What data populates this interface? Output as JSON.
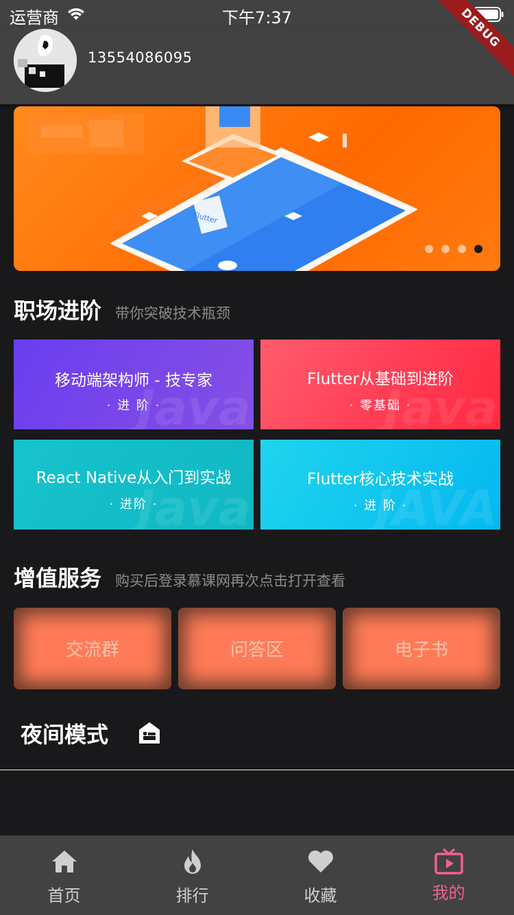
{
  "status_bar": {
    "carrier": "运营商",
    "time": "下午7:37"
  },
  "debug_banner": "DEBUG",
  "header": {
    "username": "13554086095"
  },
  "banner": {
    "page_count": 4,
    "active_page": 4,
    "accent_color": "#ff6a00",
    "illustration_label": "Flutter"
  },
  "career_section": {
    "title": "职场进阶",
    "subtitle": "带你突破技术瓶颈",
    "courses": [
      {
        "title": "移动端架构师 - 技专家",
        "level": "· 进 阶 ·",
        "watermark": "Java"
      },
      {
        "title": "Flutter从基础到进阶",
        "level": "· 零基础 ·",
        "watermark": "Java"
      },
      {
        "title": "React Native从入门到实战",
        "level": "·   进阶   ·",
        "watermark": "Java"
      },
      {
        "title": "Flutter核心技术实战",
        "level": "· 进 阶 ·",
        "watermark": "JAVA"
      }
    ]
  },
  "value_section": {
    "title": "增值服务",
    "subtitle": "购买后登录慕课网再次点击打开查看",
    "buttons": [
      {
        "label": "交流群"
      },
      {
        "label": "问答区"
      },
      {
        "label": "电子书"
      }
    ]
  },
  "night_mode": {
    "label": "夜间模式",
    "icon": "night-mode-icon"
  },
  "bottom_nav": {
    "items": [
      {
        "label": "首页",
        "icon": "home-icon"
      },
      {
        "label": "排行",
        "icon": "fire-icon"
      },
      {
        "label": "收藏",
        "icon": "heart-icon"
      },
      {
        "label": "我的",
        "icon": "tv-icon"
      }
    ],
    "active_index": 3,
    "active_color": "#f06292"
  }
}
